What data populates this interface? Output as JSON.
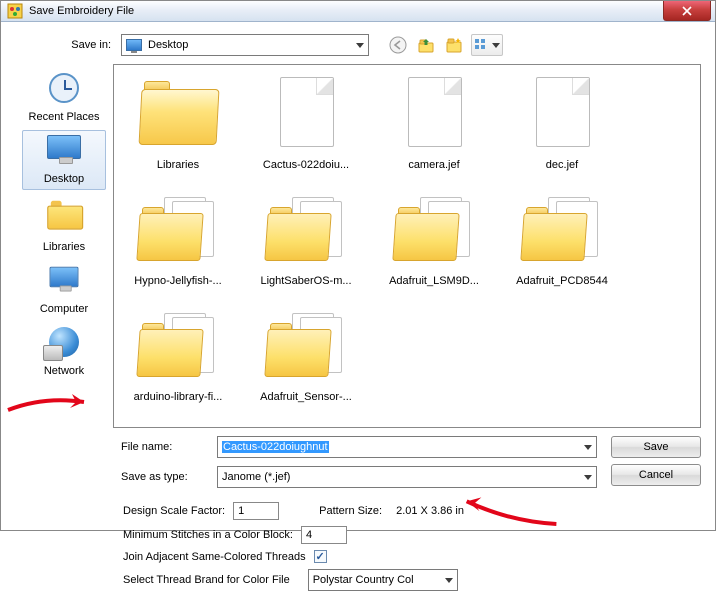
{
  "titlebar": {
    "title": "Save Embroidery File"
  },
  "savein": {
    "label": "Save in:",
    "value": "Desktop"
  },
  "places": [
    {
      "label": "Recent Places",
      "icon": "clock"
    },
    {
      "label": "Desktop",
      "icon": "monitor",
      "selected": true
    },
    {
      "label": "Libraries",
      "icon": "folder"
    },
    {
      "label": "Computer",
      "icon": "computer"
    },
    {
      "label": "Network",
      "icon": "network"
    }
  ],
  "items": [
    {
      "label": "Libraries",
      "kind": "folder-open"
    },
    {
      "label": "Cactus-022doiu...",
      "kind": "doc"
    },
    {
      "label": "camera.jef",
      "kind": "doc"
    },
    {
      "label": "dec.jef",
      "kind": "doc"
    },
    {
      "label": "Hypno-Jellyfish-...",
      "kind": "folder-stack"
    },
    {
      "label": "LightSaberOS-m...",
      "kind": "folder-stack"
    },
    {
      "label": "Adafruit_LSM9D...",
      "kind": "folder-stack"
    },
    {
      "label": "Adafruit_PCD8544",
      "kind": "folder-stack"
    },
    {
      "label": "arduino-library-fi...",
      "kind": "folder-stack"
    },
    {
      "label": "Adafruit_Sensor-...",
      "kind": "folder-stack"
    }
  ],
  "filename": {
    "label": "File name:",
    "value": "Cactus-022doiughnut"
  },
  "saveastype": {
    "label": "Save as type:",
    "value": "Janome (*.jef)"
  },
  "buttons": {
    "save": "Save",
    "cancel": "Cancel"
  },
  "opts": {
    "scale_label": "Design Scale Factor:",
    "scale_value": "1",
    "pattern_label": "Pattern Size:",
    "pattern_value": "2.01 X 3.86 in",
    "minstitch_label": "Minimum Stitches in a Color Block:",
    "minstitch_value": "4",
    "join_label": "Join Adjacent Same-Colored Threads",
    "brand_label": "Select Thread Brand for Color File",
    "brand_value": "Polystar Country Col"
  }
}
